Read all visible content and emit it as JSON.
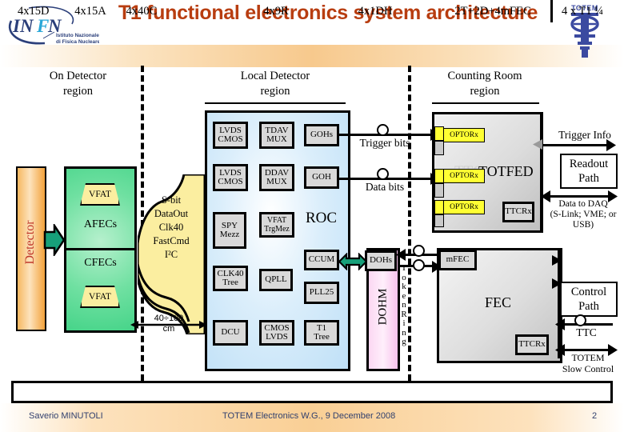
{
  "slide": {
    "title": "T1 functional electronics system architecture",
    "title_color": "#b83d10",
    "page_number": "2",
    "author": "Saverio MINUTOLI",
    "event": "TOTEM Electronics W.G., 9 December 2008",
    "logo_left_name": "INFN",
    "logo_left_sub1": "Istituto Nazionale",
    "logo_left_sub2": "di Fisica Nucleare",
    "logo_right_name": "TOTEM"
  },
  "regions": [
    {
      "line1": "On Detector",
      "line2": "region"
    },
    {
      "line1": "Local Detector",
      "line2": "region"
    },
    {
      "line1": "Counting Room",
      "line2": "region"
    }
  ],
  "on_detector": {
    "detector_label": "Detector",
    "detector_color": "#f3a23c",
    "front_end": {
      "vfat_top": "VFAT",
      "afecs": "AFECs",
      "cfecs": "CFECs",
      "vfat_bottom": "VFAT",
      "block_color": "#46d489"
    },
    "cable": {
      "lines": [
        "S-bit",
        "DataOut",
        "Clk40",
        "FastCmd",
        "I²C"
      ],
      "color": "#fbeea0"
    },
    "distance": {
      "value": "40÷100",
      "unit": "cm"
    }
  },
  "roc": {
    "title": "ROC",
    "panel_color": "#bfe0f7",
    "modules": [
      {
        "id": "lvds-cmos-1",
        "lines": [
          "LVDS",
          "CMOS"
        ]
      },
      {
        "id": "tdav-mux",
        "lines": [
          "TDAV",
          "MUX"
        ]
      },
      {
        "id": "gohs",
        "lines": [
          "GOHs"
        ]
      },
      {
        "id": "lvds-cmos-2",
        "lines": [
          "LVDS",
          "CMOS"
        ]
      },
      {
        "id": "ddav-mux",
        "lines": [
          "DDAV",
          "MUX"
        ]
      },
      {
        "id": "goh",
        "lines": [
          "GOH"
        ]
      },
      {
        "id": "spy-mezz",
        "lines": [
          "SPY",
          "Mezz"
        ]
      },
      {
        "id": "vfat-trgmez",
        "lines": [
          "VFAT",
          "TrgMez"
        ]
      },
      {
        "id": "ccum",
        "lines": [
          "CCUM"
        ]
      },
      {
        "id": "clk40-tree",
        "lines": [
          "CLK40",
          "Tree"
        ]
      },
      {
        "id": "qpll",
        "lines": [
          "QPLL"
        ]
      },
      {
        "id": "pll25",
        "lines": [
          "PLL25"
        ]
      },
      {
        "id": "dcu",
        "lines": [
          "DCU"
        ]
      },
      {
        "id": "cmos-lvds",
        "lines": [
          "CMOS",
          "LVDS"
        ]
      },
      {
        "id": "t1-tree",
        "lines": [
          "T1",
          "Tree"
        ]
      }
    ]
  },
  "links": {
    "trigger_bits": "Trigger bits",
    "data_bits": "Data bits",
    "token_ring": "Token Ring"
  },
  "counting_room": {
    "totfed": {
      "title": "TOTFED",
      "ghost": "TTC",
      "optorx": [
        "OPTORx",
        "OPTORx",
        "OPTORx"
      ],
      "ttcrx": "TTCRx",
      "optorx_color": "#ffff33"
    },
    "dohm": {
      "label": "DOHM",
      "dohs": "DOHs",
      "color": "#f7c2ec"
    },
    "fec": {
      "title": "FEC",
      "mfec": "mFEC",
      "ttcrx": "TTCRx"
    },
    "paths": {
      "trigger_info": "Trigger Info",
      "readout_path_l1": "Readout",
      "readout_path_l2": "Path",
      "data_to_daq_l1": "Data to DAQ",
      "data_to_daq_l2": "(S-Link; VME; or",
      "data_to_daq_l3": "USB)",
      "control_path_l1": "Control",
      "control_path_l2": "Path",
      "ttc": "TTC",
      "slow_control_l1": "TOTEM",
      "slow_control_l2": "Slow Control"
    }
  },
  "bottom_counts": [
    {
      "label": "4x15D"
    },
    {
      "label": "4x15A"
    },
    {
      "label": "4x40C"
    },
    {
      "label": "4x9R"
    },
    {
      "label": "4x1DH"
    },
    {
      "label": "2T+2D+4mFEC"
    },
    {
      "label": "4 x T1 ¼"
    }
  ]
}
